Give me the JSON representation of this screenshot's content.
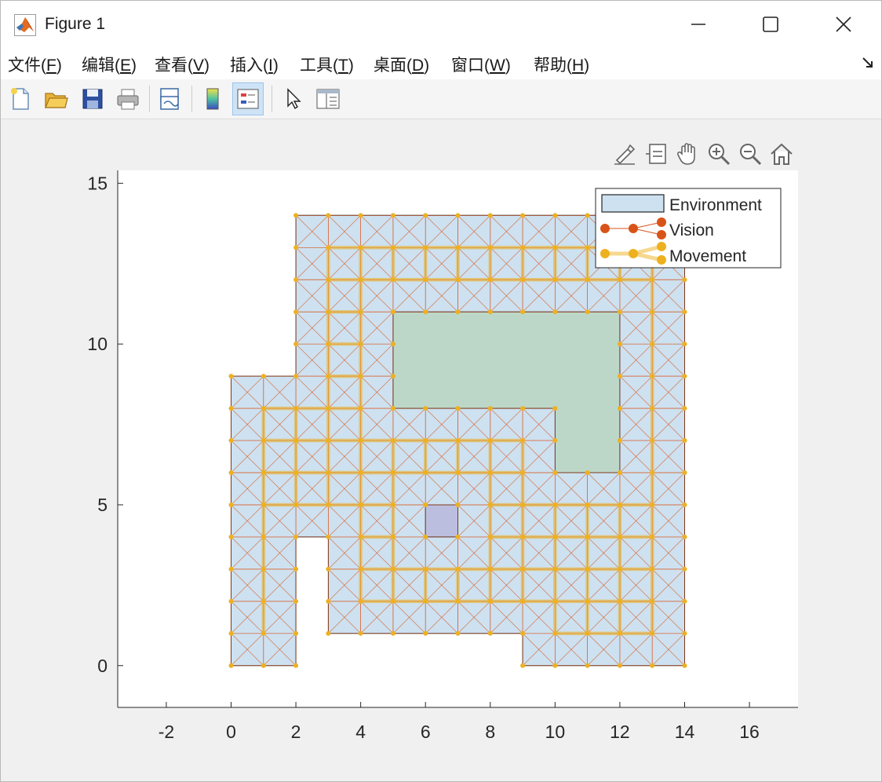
{
  "window": {
    "title": "Figure 1",
    "controls": {
      "minimize": "minimize-icon",
      "maximize": "maximize-icon",
      "close": "close-icon"
    }
  },
  "menu": [
    {
      "label": "文件(",
      "accel": "F",
      "tail": ")"
    },
    {
      "label": "编辑(",
      "accel": "E",
      "tail": ")"
    },
    {
      "label": "查看(",
      "accel": "V",
      "tail": ")"
    },
    {
      "label": "插入(",
      "accel": "I",
      "tail": ")"
    },
    {
      "label": "工具(",
      "accel": "T",
      "tail": ")"
    },
    {
      "label": "桌面(",
      "accel": "D",
      "tail": ")"
    },
    {
      "label": "窗口(",
      "accel": "W",
      "tail": ")"
    },
    {
      "label": "帮助(",
      "accel": "H",
      "tail": ")"
    }
  ],
  "toolbar": [
    "new-figure-icon",
    "open-file-icon",
    "save-icon",
    "print-icon",
    "link-plot-icon",
    "colorbar-icon",
    "legend-icon",
    "edit-plot-pointer-icon",
    "property-inspector-icon"
  ],
  "axes_toolbar": [
    "brush-icon",
    "data-tips-icon",
    "pan-hand-icon",
    "zoom-in-icon",
    "zoom-out-icon",
    "restore-view-home-icon"
  ],
  "colors": {
    "environment_fill": "#cde1f0",
    "obstacle_fill": "#bcd7c8",
    "small_obstacle_fill": "#bcbedf",
    "vision": "#d95319",
    "movement": "#edb120",
    "axes_bg": "#ffffff"
  },
  "chart_data": {
    "type": "graph-plot",
    "xlim": [
      -3.5,
      17.5
    ],
    "ylim": [
      -1.3,
      15.4
    ],
    "xticks": [
      -2,
      0,
      2,
      4,
      6,
      8,
      10,
      12,
      14,
      16
    ],
    "yticks": [
      0,
      5,
      10,
      15
    ],
    "grid": false,
    "legend": {
      "location": "top-right",
      "entries": [
        "Environment",
        "Vision",
        "Movement"
      ]
    },
    "environment_boundary": [
      [
        0,
        0
      ],
      [
        2,
        0
      ],
      [
        2,
        4
      ],
      [
        3,
        4
      ],
      [
        3,
        1
      ],
      [
        9,
        1
      ],
      [
        9,
        0
      ],
      [
        14,
        0
      ],
      [
        14,
        14
      ],
      [
        2,
        14
      ],
      [
        2,
        9
      ],
      [
        0,
        9
      ]
    ],
    "obstacles": [
      {
        "vertices": [
          [
            5,
            11
          ],
          [
            12,
            11
          ],
          [
            12,
            6
          ],
          [
            10,
            6
          ],
          [
            10,
            8
          ],
          [
            5,
            8
          ]
        ],
        "fill": "obstacle_fill"
      },
      {
        "vertices": [
          [
            6,
            4
          ],
          [
            7,
            4
          ],
          [
            7,
            5
          ],
          [
            6,
            5
          ]
        ],
        "fill": "small_obstacle_fill"
      }
    ],
    "vision_grid_spacing": 1,
    "vision_diagonals": true,
    "movement_grid_spacing": 1
  }
}
